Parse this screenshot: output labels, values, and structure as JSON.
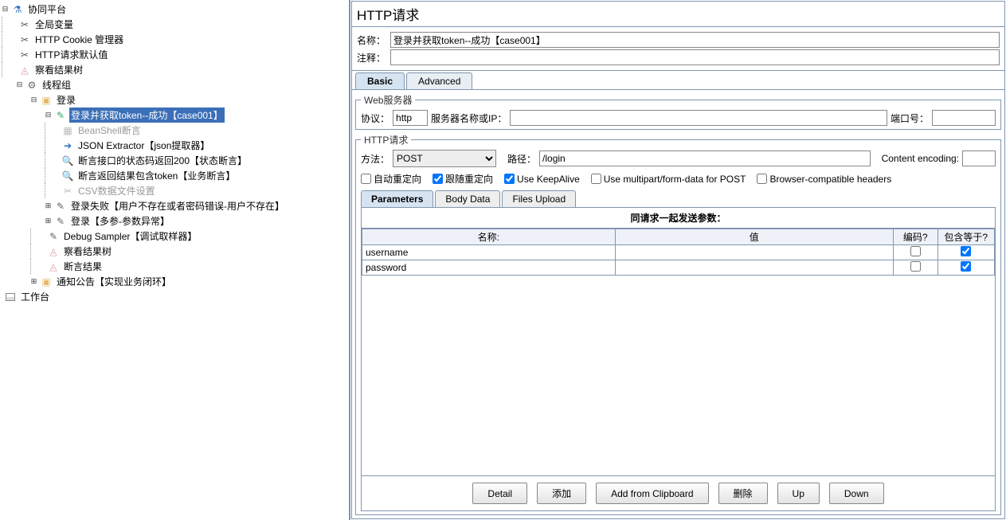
{
  "tree": {
    "root": "协同平台",
    "global_vars": "全局变量",
    "cookie_mgr": "HTTP Cookie 管理器",
    "http_defaults": "HTTP请求默认值",
    "view_results": "察看结果树",
    "thread_group": "线程组",
    "login": "登录",
    "login_success": "登录并获取token--成功【case001】",
    "beanshell": "BeanShell断言",
    "json_extractor": "JSON Extractor【json提取器】",
    "assert_200": "断言接口的状态码返回200【状态断言】",
    "assert_token": "断言返回结果包含token【业务断言】",
    "csv_data": "CSV数据文件设置",
    "login_fail": "登录失败【用户不存在或者密码错误-用户不存在】",
    "login_params": "登录【多参-参数异常】",
    "debug_sampler": "Debug Sampler【调试取样器】",
    "view_results2": "察看结果树",
    "assert_results": "断言结果",
    "notice": "通知公告【实现业务闭环】",
    "workbench": "工作台"
  },
  "panel": {
    "title": "HTTP请求",
    "name_label": "名称：",
    "name_value": "登录并获取token--成功【case001】",
    "comment_label": "注释：",
    "tab_basic": "Basic",
    "tab_advanced": "Advanced",
    "webserver_legend": "Web服务器",
    "protocol_label": "协议：",
    "protocol_value": "http",
    "server_label": "服务器名称或IP：",
    "server_value": "",
    "port_label": "端口号：",
    "port_value": "",
    "httpreq_legend": "HTTP请求",
    "method_label": "方法：",
    "method_value": "POST",
    "path_label": "路径：",
    "path_value": "/login",
    "encoding_label": "Content encoding:",
    "cb_auto": "自动重定向",
    "cb_follow": "跟随重定向",
    "cb_keepalive": "Use KeepAlive",
    "cb_multipart": "Use multipart/form-data for POST",
    "cb_browser": "Browser-compatible headers",
    "ptab_params": "Parameters",
    "ptab_body": "Body Data",
    "ptab_files": "Files Upload",
    "params_title": "同请求一起发送参数：",
    "col_name": "名称:",
    "col_value": "值",
    "col_encode": "编码?",
    "col_include": "包含等于?",
    "rows": [
      {
        "name": "username",
        "value": "",
        "encode": false,
        "include": true
      },
      {
        "name": "password",
        "value": "",
        "encode": false,
        "include": true
      }
    ],
    "btn_detail": "Detail",
    "btn_add": "添加",
    "btn_clipboard": "Add from Clipboard",
    "btn_delete": "删除",
    "btn_up": "Up",
    "btn_down": "Down"
  }
}
